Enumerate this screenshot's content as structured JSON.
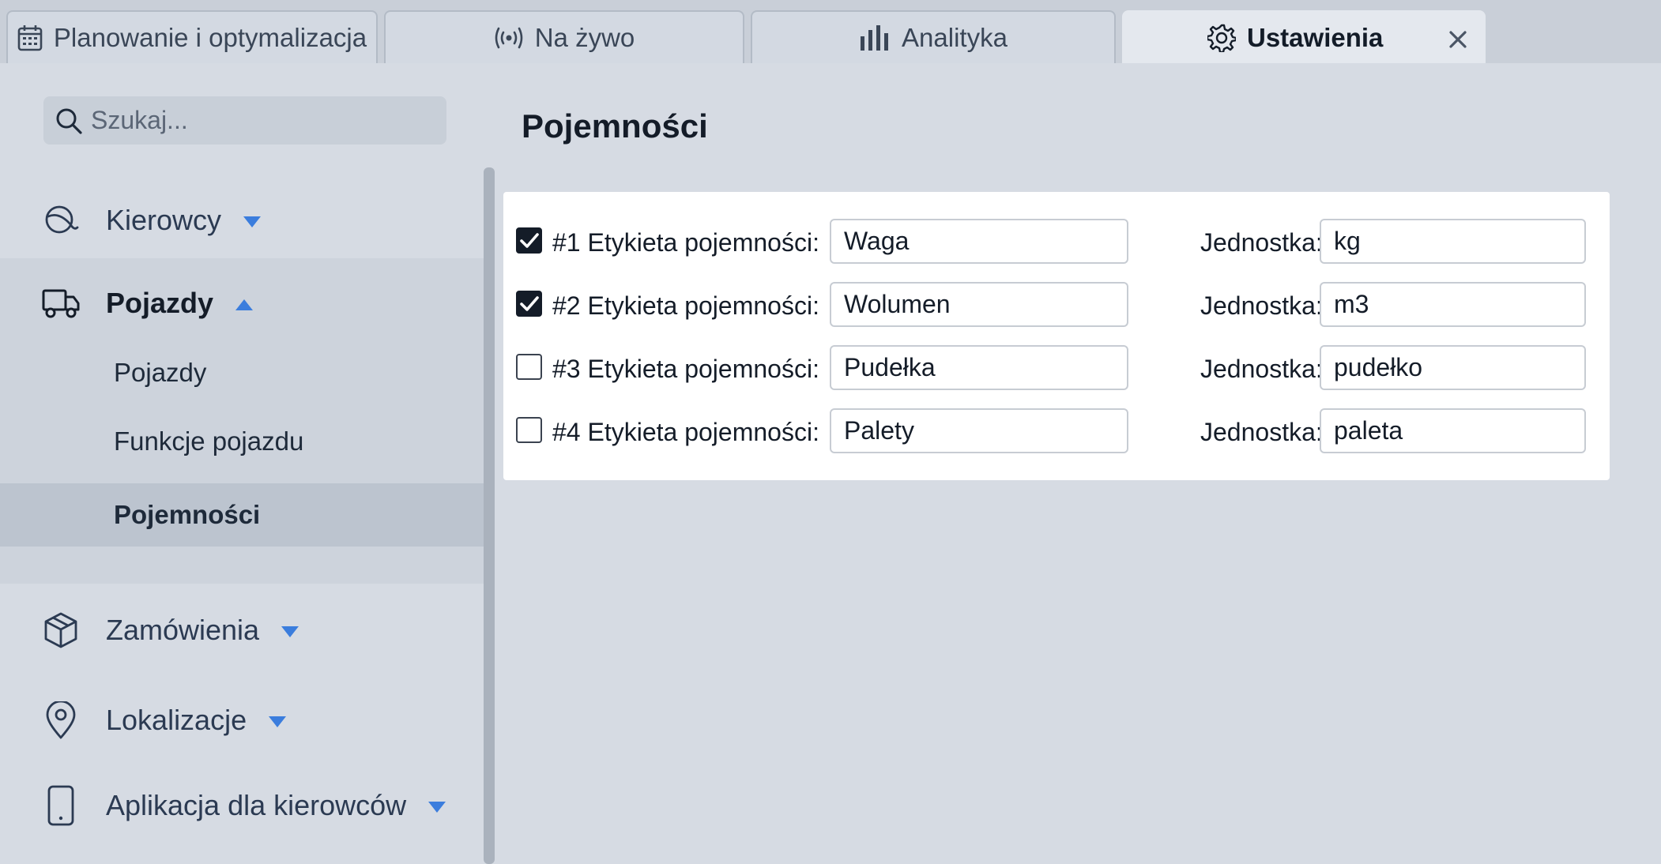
{
  "tabs": [
    {
      "label": "Planowanie i optymalizacja",
      "icon": "calendar-icon"
    },
    {
      "label": "Na żywo",
      "icon": "live-broadcast-icon"
    },
    {
      "label": "Analityka",
      "icon": "bar-chart-icon"
    },
    {
      "label": "Ustawienia",
      "icon": "gear-icon",
      "active": true
    }
  ],
  "sidebar": {
    "search_placeholder": "Szukaj...",
    "items": [
      {
        "label": "Kierowcy",
        "icon": "driver-icon",
        "expanded": false
      },
      {
        "label": "Pojazdy",
        "icon": "truck-icon",
        "expanded": true,
        "children": [
          {
            "label": "Pojazdy"
          },
          {
            "label": "Funkcje pojazdu"
          },
          {
            "label": "Pojemności",
            "selected": true
          }
        ]
      },
      {
        "label": "Zamówienia",
        "icon": "package-icon",
        "expanded": false
      },
      {
        "label": "Lokalizacje",
        "icon": "location-pin-icon",
        "expanded": false
      },
      {
        "label": "Aplikacja dla kierowców",
        "icon": "mobile-phone-icon",
        "expanded": false
      }
    ]
  },
  "main": {
    "title": "Pojemności",
    "unit_label": "Jednostka:",
    "rows": [
      {
        "label": "#1 Etykieta pojemności:",
        "checked": true,
        "name": "Waga",
        "unit": "kg"
      },
      {
        "label": "#2 Etykieta pojemności:",
        "checked": true,
        "name": "Wolumen",
        "unit": "m3"
      },
      {
        "label": "#3 Etykieta pojemności:",
        "checked": false,
        "name": "Pudełka",
        "unit": "pudełko"
      },
      {
        "label": "#4 Etykieta pojemności:",
        "checked": false,
        "name": "Palety",
        "unit": "paleta"
      }
    ]
  },
  "colors": {
    "accent": "#3b7ddd",
    "background": "#d6dbe3",
    "card": "#ffffff",
    "selected_item": "#bcc4cf"
  }
}
